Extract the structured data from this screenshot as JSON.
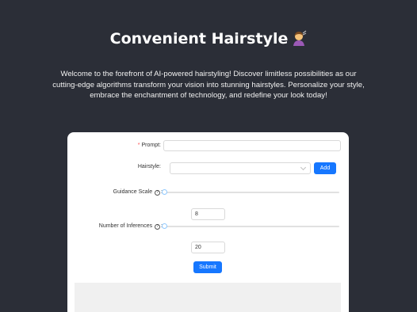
{
  "header": {
    "title": "Convenient Hairstyle",
    "title_emoji": "person-getting-haircut",
    "intro": "Welcome to the forefront of AI-powered hairstyling! Discover limitless possibilities as our cutting-edge algorithms transform your vision into stunning hairstyles. Personalize your style, embrace the enchantment of technology, and redefine your look today!"
  },
  "form": {
    "prompt_label": "Prompt",
    "prompt_value": "",
    "hairstyle_label": "Hairstyle",
    "hairstyle_value": "",
    "add_label": "Add",
    "guidance_label": "Guidance Scale",
    "guidance_value": "8",
    "inferences_label": "Number of Inferences",
    "inferences_value": "20",
    "submit_label": "Submit",
    "help_glyph": "?"
  },
  "colors": {
    "background": "#2b2e37",
    "primary": "#1677ff",
    "required": "#ff4d4f"
  }
}
